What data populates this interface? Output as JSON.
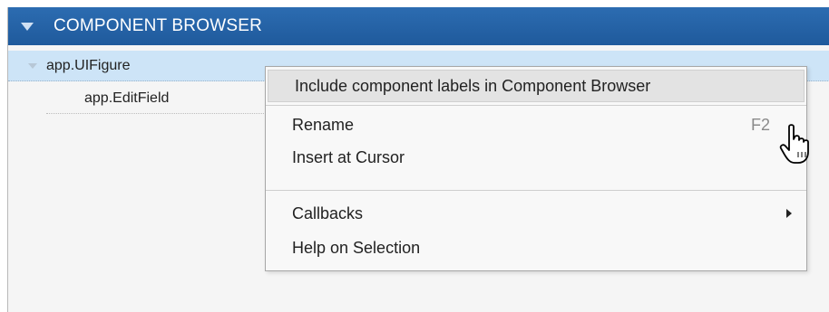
{
  "panel": {
    "title": "COMPONENT BROWSER",
    "header_color": "#2060a5"
  },
  "tree": {
    "items": [
      {
        "label": "app.UIFigure",
        "selected": true,
        "expanded": true
      },
      {
        "label": "app.EditField",
        "selected": false
      }
    ]
  },
  "context_menu": {
    "items": [
      {
        "label": "Include component labels in Component Browser",
        "highlighted": true
      },
      {
        "label": "Rename",
        "shortcut": "F2"
      },
      {
        "label": "Insert at Cursor"
      },
      {
        "label": "Callbacks",
        "has_submenu": true
      },
      {
        "label": "Help on Selection"
      }
    ]
  },
  "cursor": {
    "icon": "hand-pointer-icon"
  }
}
